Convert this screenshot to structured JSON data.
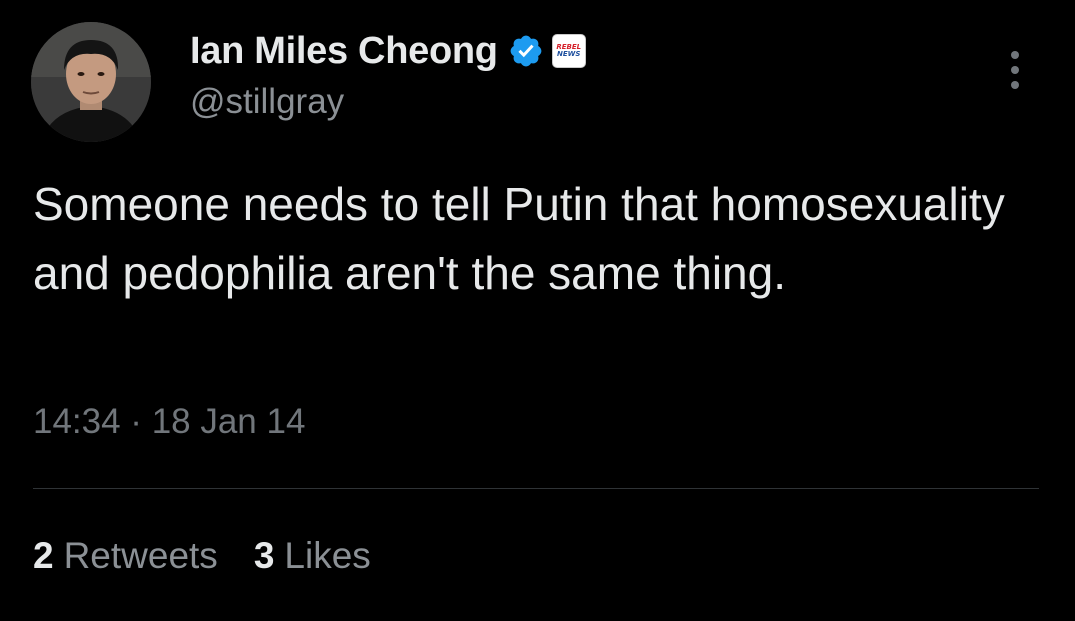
{
  "author": {
    "display_name": "Ian Miles Cheong",
    "handle": "@stillgray",
    "verified": true,
    "affiliate_badge": {
      "line1": "REBEL",
      "line2": "NEWS"
    }
  },
  "tweet": {
    "text": "Someone needs to tell Putin that homosexuality and pedophilia aren't the same thing.",
    "timestamp": "14:34 · 18 Jan 14"
  },
  "stats": {
    "retweets_count": "2",
    "retweets_label": "Retweets",
    "likes_count": "3",
    "likes_label": "Likes"
  },
  "icons": {
    "verified": "verified-badge-icon",
    "more": "more-options-icon"
  },
  "colors": {
    "background": "#000000",
    "primary_text": "#e7e9ea",
    "secondary_text": "#71767b",
    "verified_blue": "#1d9bf0",
    "divider": "#2f3336"
  }
}
